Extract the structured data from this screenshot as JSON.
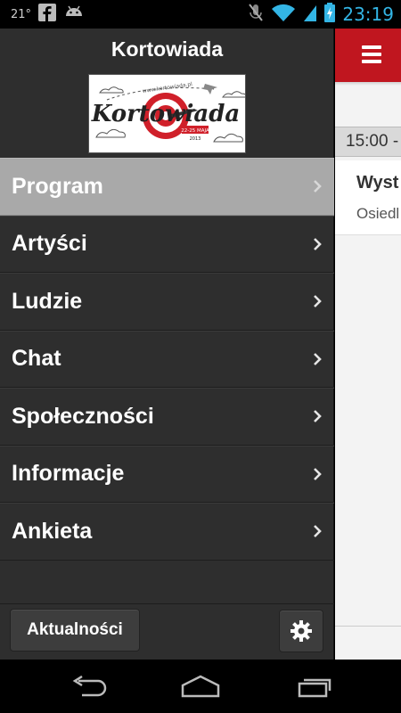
{
  "statusbar": {
    "temperature": "21°",
    "time": "23:19",
    "icons": [
      "facebook-icon",
      "android-icon",
      "mute-icon",
      "wifi-icon",
      "signal-icon",
      "battery-charging-icon"
    ]
  },
  "drawer": {
    "title": "Kortowiada",
    "logo": {
      "text": "Kortowiada",
      "url_text": "www.kortowiada.pl",
      "dates": "22-25 MAJA",
      "year": "2013"
    },
    "menu": [
      {
        "label": "Program",
        "active": true
      },
      {
        "label": "Artyści",
        "active": false
      },
      {
        "label": "Ludzie",
        "active": false
      },
      {
        "label": "Chat",
        "active": false
      },
      {
        "label": "Społeczności",
        "active": false
      },
      {
        "label": "Informacje",
        "active": false
      },
      {
        "label": "Ankieta",
        "active": false
      }
    ],
    "bottom": {
      "news_button": "Aktualności",
      "settings_icon": "gear-icon"
    }
  },
  "main": {
    "appbar_color": "#c0161f",
    "section_header": "15:00 -",
    "card_title": "Wyst",
    "card_subtitle": "Osiedl"
  },
  "navbar": {
    "icons": [
      "back-icon",
      "home-icon",
      "recent-apps-icon"
    ]
  },
  "colors": {
    "accent_red": "#c0161f",
    "drawer_bg": "#2e2e2e",
    "active_item_bg": "#a9a9a9",
    "clock_blue": "#33b5e5"
  }
}
